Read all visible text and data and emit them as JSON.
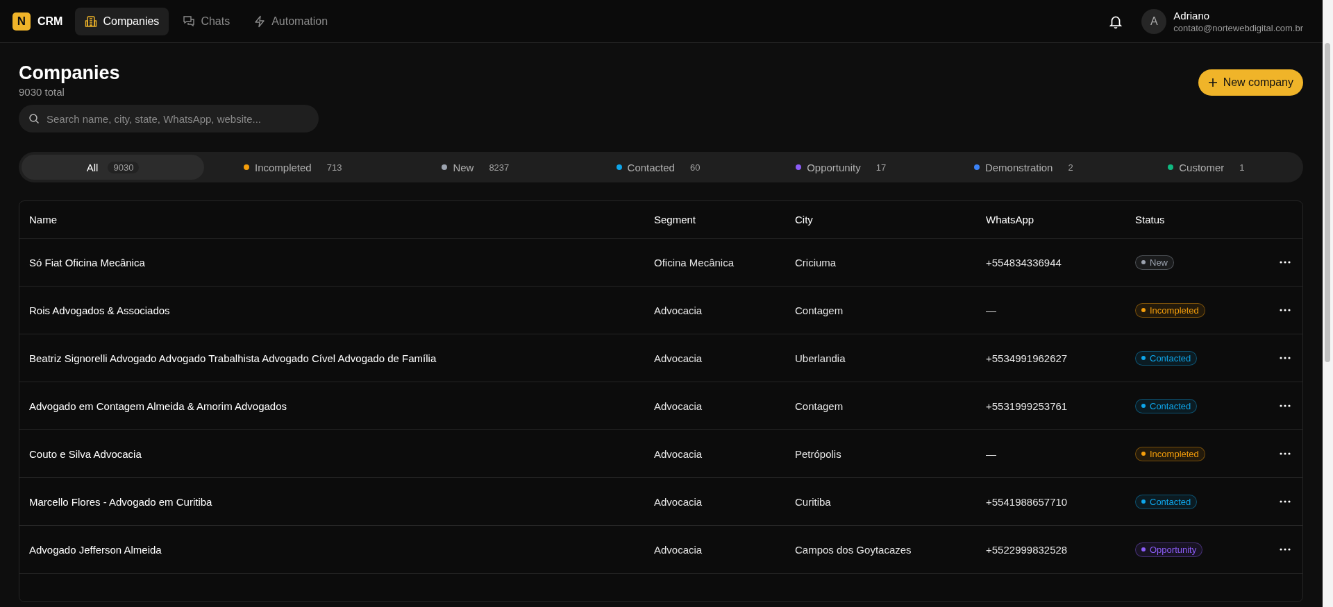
{
  "topbar": {
    "logo_letter": "N",
    "app_name": "CRM",
    "nav": [
      {
        "label": "Companies",
        "selected": true
      },
      {
        "label": "Chats",
        "selected": false
      },
      {
        "label": "Automation",
        "selected": false
      }
    ],
    "user": {
      "initial": "A",
      "name": "Adriano",
      "email": "contato@nortewebdigital.com.br"
    }
  },
  "header": {
    "title": "Companies",
    "subtitle": "9030 total",
    "new_button": "New company"
  },
  "search": {
    "placeholder": "Search name, city, state, WhatsApp, website..."
  },
  "filters": [
    {
      "label": "All",
      "count": "9030",
      "selected": true
    },
    {
      "label": "Incompleted",
      "count": "713",
      "color": "#f59e0b",
      "selected": false
    },
    {
      "label": "New",
      "count": "8237",
      "color": "#9ca3af",
      "selected": false
    },
    {
      "label": "Contacted",
      "count": "60",
      "color": "#0ea5e9",
      "selected": false
    },
    {
      "label": "Opportunity",
      "count": "17",
      "color": "#8b5cf6",
      "selected": false
    },
    {
      "label": "Demonstration",
      "count": "2",
      "color": "#3b82f6",
      "selected": false
    },
    {
      "label": "Customer",
      "count": "1",
      "color": "#10b981",
      "selected": false
    }
  ],
  "table": {
    "columns": [
      "Name",
      "Segment",
      "City",
      "WhatsApp",
      "Status"
    ],
    "rows": [
      {
        "name": "Só Fiat Oficina Mecânica",
        "segment": "Oficina Mecânica",
        "city": "Criciuma",
        "whatsapp": "+554834336944",
        "status": "New",
        "color": "#9ca3af"
      },
      {
        "name": "Rois Advogados & Associados",
        "segment": "Advocacia",
        "city": "Contagem",
        "whatsapp": "—",
        "status": "Incompleted",
        "color": "#f59e0b"
      },
      {
        "name": "Beatriz Signorelli Advogado Advogado Trabalhista Advogado Cível Advogado de Família",
        "segment": "Advocacia",
        "city": "Uberlandia",
        "whatsapp": "+5534991962627",
        "status": "Contacted",
        "color": "#0ea5e9"
      },
      {
        "name": "Advogado em Contagem Almeida & Amorim Advogados",
        "segment": "Advocacia",
        "city": "Contagem",
        "whatsapp": "+5531999253761",
        "status": "Contacted",
        "color": "#0ea5e9"
      },
      {
        "name": "Couto e Silva Advocacia",
        "segment": "Advocacia",
        "city": "Petrópolis",
        "whatsapp": "—",
        "status": "Incompleted",
        "color": "#f59e0b"
      },
      {
        "name": "Marcello Flores - Advogado em Curitiba",
        "segment": "Advocacia",
        "city": "Curitiba",
        "whatsapp": "+5541988657710",
        "status": "Contacted",
        "color": "#0ea5e9"
      },
      {
        "name": "Advogado Jefferson Almeida",
        "segment": "Advocacia",
        "city": "Campos dos Goytacazes",
        "whatsapp": "+5522999832528",
        "status": "Opportunity",
        "color": "#8b5cf6"
      }
    ]
  }
}
